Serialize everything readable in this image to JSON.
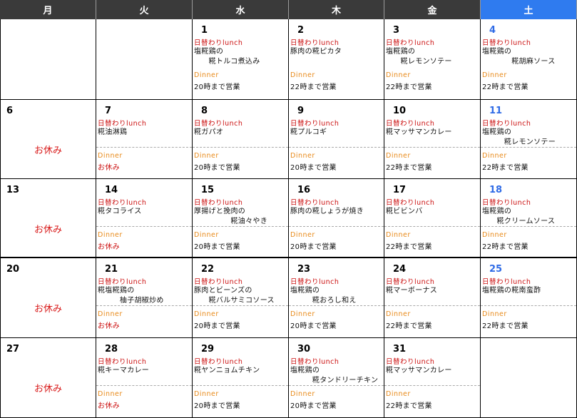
{
  "weekdays": [
    "月",
    "火",
    "水",
    "木",
    "金",
    "土"
  ],
  "colors": {
    "header": "#3a3a3a",
    "saturday_header": "#2f7bef",
    "lunch": "#cc1111",
    "dinner": "#e88a1a",
    "closed": "#d81a1a"
  },
  "lunch_heading": "日替わりlunch",
  "dinner_heading": "Dinner",
  "closed_label": "お休み",
  "weeks": [
    [
      {
        "date": "",
        "empty": true
      },
      {
        "date": "",
        "empty": true
      },
      {
        "date": "1",
        "menu": "塩糀鶏の\n　　糀トルコ煮込み",
        "dinner": "20時まで営業"
      },
      {
        "date": "2",
        "menu": "豚肉の糀ピカタ",
        "dinner": "22時まで営業"
      },
      {
        "date": "3",
        "menu": "塩糀鶏の\n　　糀レモンソテー",
        "dinner": "22時まで営業"
      },
      {
        "date": "4",
        "menu": "塩糀鶏の\n　　　　糀胡麻ソース",
        "dinner": "22時まで営業"
      }
    ],
    [
      {
        "date": "6",
        "closed": true
      },
      {
        "date": "7",
        "menu": "糀油淋鶏",
        "dinner": "お休み"
      },
      {
        "date": "8",
        "menu": "糀ガパオ",
        "dinner": "20時まで営業"
      },
      {
        "date": "9",
        "menu": "糀プルコギ",
        "dinner": "20時まで営業"
      },
      {
        "date": "10",
        "menu": "糀マッサマンカレー",
        "dinner": "22時まで営業"
      },
      {
        "date": "11",
        "menu": "塩糀鶏の\n　　　糀レモンソテー",
        "dinner": "22時まで営業"
      }
    ],
    [
      {
        "date": "13",
        "closed": true
      },
      {
        "date": "14",
        "menu": "糀タコライス",
        "dinner": "お休み"
      },
      {
        "date": "15",
        "menu": "厚揚げと挽肉の\n　　　　　糀油々やき",
        "dinner": "20時まで営業"
      },
      {
        "date": "16",
        "menu": "豚肉の糀しょうが焼き",
        "dinner": "20時まで営業"
      },
      {
        "date": "17",
        "menu": "糀ビビンバ",
        "dinner": "22時まで営業"
      },
      {
        "date": "18",
        "menu": "塩糀鶏の\n　　糀クリームソース",
        "dinner": "22時まで営業"
      }
    ],
    [
      {
        "date": "20",
        "closed": true
      },
      {
        "date": "21",
        "menu": "糀塩糀鶏の\n　　　柚子胡椒炒め",
        "dinner": "お休み"
      },
      {
        "date": "22",
        "menu": "豚肉とビーンズの\n　　糀バルサミコソース",
        "dinner": "20時まで営業"
      },
      {
        "date": "23",
        "menu": "塩糀鶏の\n　　　糀おろし和え",
        "dinner": "20時まで営業"
      },
      {
        "date": "24",
        "menu": "糀マーボーナス",
        "dinner": "22時まで営業"
      },
      {
        "date": "25",
        "menu": "塩糀鶏の糀南蛮酢",
        "dinner": "22時まで営業"
      }
    ],
    [
      {
        "date": "27",
        "closed": true
      },
      {
        "date": "28",
        "menu": "糀キーマカレー",
        "dinner": "お休み"
      },
      {
        "date": "29",
        "menu": "糀ヤンニョムチキン",
        "dinner": "20時まで営業"
      },
      {
        "date": "30",
        "menu": "塩糀鶏の\n　　　糀タンドリーチキン",
        "dinner": "20時まで営業"
      },
      {
        "date": "31",
        "menu": "糀マッサマンカレー",
        "dinner": "22時まで営業"
      },
      {
        "date": "",
        "empty": true
      }
    ]
  ]
}
